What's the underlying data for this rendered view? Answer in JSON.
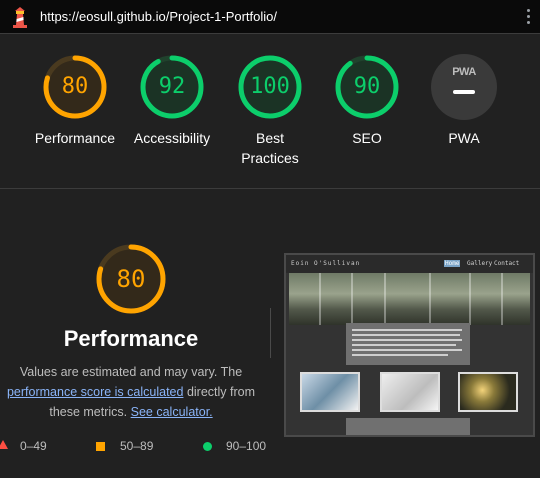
{
  "browser": {
    "url": "https://eosull.github.io/Project-1-Portfolio/",
    "logo_icon": "lighthouse-icon",
    "menu_icon": "more-vertical-icon"
  },
  "colors": {
    "fail": "#ff4e42",
    "average": "#ffa400",
    "pass": "#0cce6b",
    "link": "#8ab4f8"
  },
  "summary": {
    "gauges": [
      {
        "label": "Performance",
        "score": 80,
        "status": "average"
      },
      {
        "label": "Accessibility",
        "score": 92,
        "status": "pass"
      },
      {
        "label": "Best Practices",
        "label_line1": "Best",
        "label_line2": "Practices",
        "score": 100,
        "status": "pass"
      },
      {
        "label": "SEO",
        "score": 90,
        "status": "pass"
      }
    ],
    "pwa": {
      "label": "PWA",
      "badge": "PWA"
    }
  },
  "detail": {
    "score": 80,
    "title": "Performance",
    "desc_part1": "Values are estimated and may vary. The",
    "link1": "performance score is calculated",
    "desc_part2": "directly from",
    "desc_part3": "these metrics.",
    "link2": "See calculator."
  },
  "legend": [
    {
      "range": "0–49",
      "shape": "triangle"
    },
    {
      "range": "50–89",
      "shape": "square"
    },
    {
      "range": "90–100",
      "shape": "circle"
    }
  ],
  "screenshot": {
    "site_name": "Eoin O'Sullivan",
    "nav": [
      "Home",
      "Gallery",
      "Contact"
    ]
  }
}
